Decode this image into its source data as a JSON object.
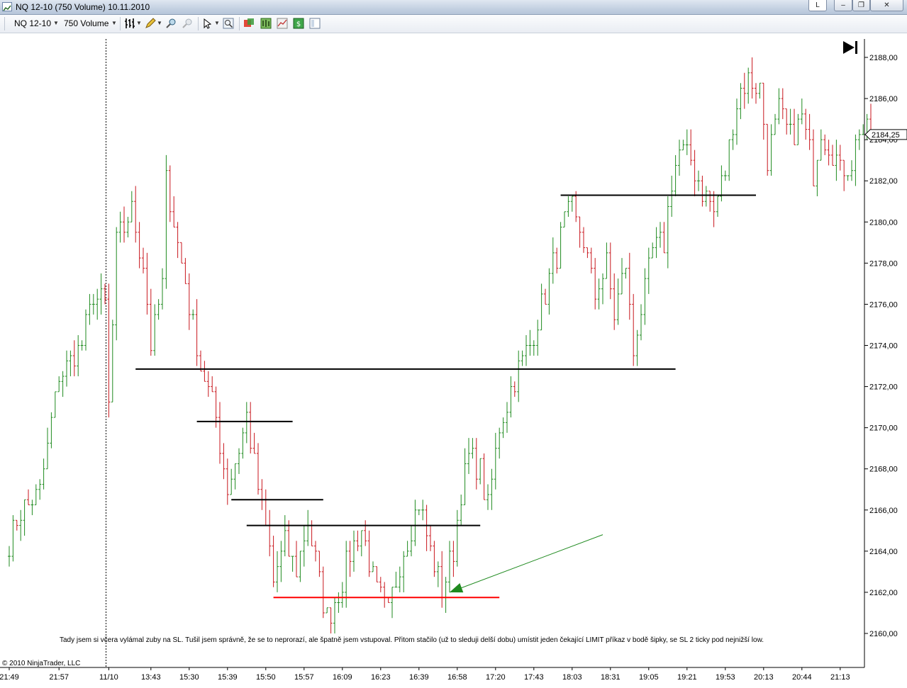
{
  "window": {
    "title": "NQ 12-10 (750 Volume)  10.11.2010",
    "buttons": {
      "l": "L",
      "minimize": "–",
      "restore": "❐",
      "close": "✕"
    }
  },
  "toolbar": {
    "instrument": "NQ 12-10",
    "period": "750 Volume",
    "icons": [
      "bar-style-icon",
      "pencil-draw-icon",
      "zoom-in-icon",
      "zoom-out-icon",
      "cursor-icon",
      "magnifier-icon",
      "data-box-icon",
      "chart-properties-icon",
      "indicators-icon",
      "strategies-icon",
      "panels-icon"
    ]
  },
  "chart": {
    "annotation": "Tady jsem si včera vylámal zuby na SL. Tušil jsem správně, že se to neprorazí, ale špatně jsem vstupoval. Přitom stačilo (už to sleduji delší dobu) umístit jeden čekající LIMIT příkaz v bodě šipky, se SL 2 ticky pod nejnižší low.",
    "copyright": "© 2010 NinjaTrader, LLC",
    "last_price_label": "2184,25"
  },
  "chart_data": {
    "type": "ohlc",
    "instrument": "NQ 12-10",
    "bar_type": "750 Volume",
    "y_ticks": [
      "2160,00",
      "2162,00",
      "2164,00",
      "2166,00",
      "2168,00",
      "2170,00",
      "2172,00",
      "2174,00",
      "2176,00",
      "2178,00",
      "2180,00",
      "2182,00",
      "2184,00",
      "2186,00",
      "2188,00"
    ],
    "ylim": [
      2159.5,
      2189.3
    ],
    "x_tick_labels": [
      "21:49",
      "21:57",
      "11/10",
      "13:43",
      "15:30",
      "15:39",
      "15:50",
      "15:57",
      "16:09",
      "16:23",
      "16:39",
      "16:58",
      "17:20",
      "17:43",
      "18:03",
      "18:31",
      "19:05",
      "19:21",
      "19:53",
      "20:13",
      "20:44",
      "21:13"
    ],
    "x_tick_index": [
      0,
      13,
      26,
      37,
      47,
      57,
      67,
      77,
      87,
      97,
      107,
      117,
      127,
      137,
      147,
      157,
      167,
      177,
      187,
      197,
      207,
      217
    ],
    "bar_count": 226,
    "session_break_index": 25,
    "last_price": 2184.25,
    "price_path": [
      [
        0,
        2164.5
      ],
      [
        3,
        2166.0
      ],
      [
        8,
        2166.8
      ],
      [
        13,
        2172.5
      ],
      [
        19,
        2174.0
      ],
      [
        22,
        2176.5
      ],
      [
        25,
        2176.0
      ],
      [
        26,
        2171.0
      ],
      [
        28,
        2179.0
      ],
      [
        32,
        2180.5
      ],
      [
        35,
        2178.0
      ],
      [
        37,
        2174.0
      ],
      [
        40,
        2177.0
      ],
      [
        41,
        2182.0
      ],
      [
        45,
        2178.0
      ],
      [
        47,
        2176.0
      ],
      [
        50,
        2173.0
      ],
      [
        54,
        2170.5
      ],
      [
        57,
        2167.0
      ],
      [
        60,
        2169.0
      ],
      [
        62,
        2170.5
      ],
      [
        66,
        2166.0
      ],
      [
        68,
        2164.0
      ],
      [
        69,
        2162.5
      ],
      [
        72,
        2164.5
      ],
      [
        75,
        2163.0
      ],
      [
        78,
        2165.5
      ],
      [
        81,
        2162.5
      ],
      [
        83,
        2160.8
      ],
      [
        86,
        2162.0
      ],
      [
        89,
        2164.0
      ],
      [
        92,
        2165.0
      ],
      [
        96,
        2162.0
      ],
      [
        99,
        2161.0
      ],
      [
        102,
        2163.5
      ],
      [
        107,
        2166.5
      ],
      [
        110,
        2164.0
      ],
      [
        113,
        2162.0
      ],
      [
        116,
        2164.0
      ],
      [
        118,
        2167.0
      ],
      [
        120,
        2168.5
      ],
      [
        123,
        2168.0
      ],
      [
        125,
        2166.0
      ],
      [
        128,
        2170.0
      ],
      [
        132,
        2172.5
      ],
      [
        136,
        2174.0
      ],
      [
        140,
        2176.5
      ],
      [
        143,
        2178.5
      ],
      [
        145,
        2180.0
      ],
      [
        147,
        2180.5
      ],
      [
        150,
        2179.0
      ],
      [
        153,
        2176.5
      ],
      [
        156,
        2178.0
      ],
      [
        158,
        2175.5
      ],
      [
        161,
        2178.0
      ],
      [
        163,
        2173.5
      ],
      [
        164,
        2175.0
      ],
      [
        166,
        2176.5
      ],
      [
        168,
        2178.5
      ],
      [
        171,
        2179.0
      ],
      [
        173,
        2182.0
      ],
      [
        175,
        2183.5
      ],
      [
        178,
        2183.0
      ],
      [
        181,
        2181.5
      ],
      [
        183,
        2181.0
      ],
      [
        184,
        2180.5
      ],
      [
        187,
        2182.5
      ],
      [
        189,
        2185.0
      ],
      [
        191,
        2186.5
      ],
      [
        193,
        2187.0
      ],
      [
        196,
        2186.5
      ],
      [
        198,
        2183.0
      ],
      [
        201,
        2185.5
      ],
      [
        204,
        2184.0
      ],
      [
        207,
        2185.0
      ],
      [
        210,
        2182.5
      ],
      [
        212,
        2184.5
      ],
      [
        215,
        2183.5
      ],
      [
        217,
        2182.5
      ],
      [
        220,
        2183.0
      ],
      [
        222,
        2184.5
      ],
      [
        225,
        2184.25
      ]
    ],
    "lines": [
      {
        "price": 2172.85,
        "from": 33,
        "to": 174,
        "color": "#000000"
      },
      {
        "price": 2170.3,
        "from": 49,
        "to": 74,
        "color": "#000000"
      },
      {
        "price": 2166.5,
        "from": 58,
        "to": 82,
        "color": "#000000"
      },
      {
        "price": 2165.25,
        "from": 62,
        "to": 123,
        "color": "#000000"
      },
      {
        "price": 2181.3,
        "from": 144,
        "to": 195,
        "color": "#000000"
      },
      {
        "price": 2161.75,
        "from": 69,
        "to": 128,
        "color": "#ff0000"
      }
    ],
    "arrow": {
      "from": [
        155,
        2164.8
      ],
      "to": [
        115,
        2162.0
      ],
      "color": "#1f8a1f"
    },
    "colors": {
      "up": "#1f8a1f",
      "down": "#c8161d",
      "grid": "none"
    }
  }
}
